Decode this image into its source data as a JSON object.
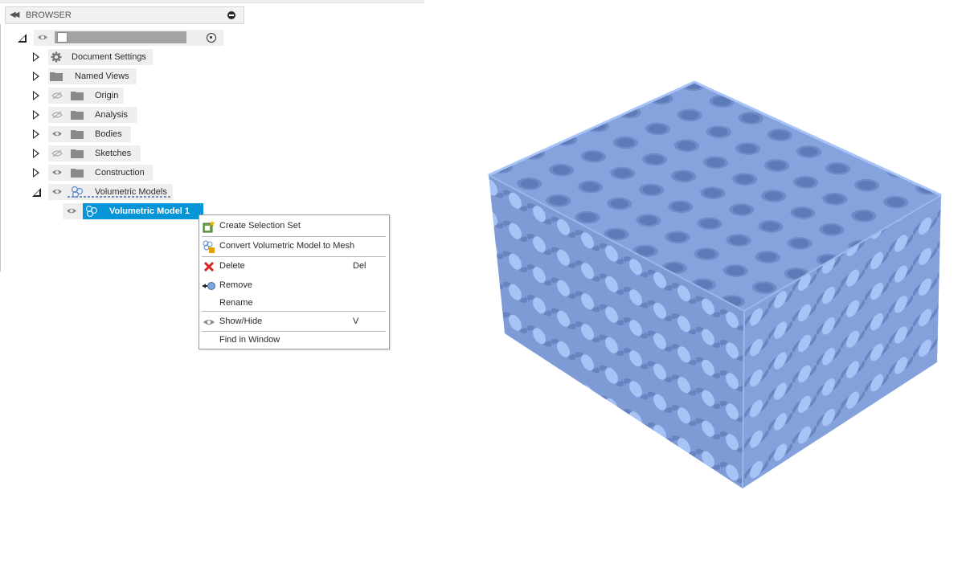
{
  "browser": {
    "title": "BROWSER",
    "root": {
      "name": ""
    },
    "items": [
      {
        "label": "Document Settings"
      },
      {
        "label": "Named Views"
      },
      {
        "label": "Origin"
      },
      {
        "label": "Analysis"
      },
      {
        "label": "Bodies"
      },
      {
        "label": "Sketches"
      },
      {
        "label": "Construction"
      },
      {
        "label": "Volumetric Models"
      }
    ],
    "child": {
      "label": "Volumetric Model 1"
    }
  },
  "context_menu": {
    "items": [
      {
        "label": "Create Selection Set",
        "shortcut": ""
      },
      {
        "label": "Convert Volumetric Model to Mesh",
        "shortcut": ""
      },
      {
        "label": "Delete",
        "shortcut": "Del"
      },
      {
        "label": "Remove",
        "shortcut": ""
      },
      {
        "label": "Rename",
        "shortcut": ""
      },
      {
        "label": "Show/Hide",
        "shortcut": "V"
      },
      {
        "label": "Find in Window",
        "shortcut": ""
      }
    ]
  },
  "colors": {
    "selection": "#0696d7",
    "model_face": "#86a3de",
    "model_hole": "#a8c4f7"
  }
}
